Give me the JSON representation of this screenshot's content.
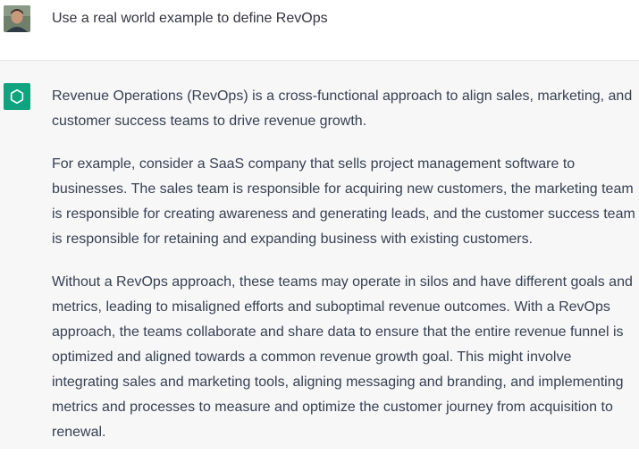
{
  "user_message": {
    "text": "Use a real world example to define RevOps"
  },
  "assistant_message": {
    "paragraphs": [
      {
        "lines": [
          "Revenue Operations (RevOps) is a cross-functional approach to align sales, marketing, and",
          "customer success teams to drive revenue growth."
        ]
      },
      {
        "lines": [
          "For example, consider a SaaS company that sells project management software to",
          "businesses. The sales team is responsible for acquiring new customers, the marketing team",
          "is responsible for creating awareness and generating leads, and the customer success team",
          "is responsible for retaining and expanding business with existing customers."
        ]
      },
      {
        "lines": [
          "Without a RevOps approach, these teams may operate in silos and have different goals and",
          "metrics, leading to misaligned efforts and suboptimal revenue outcomes. With a RevOps",
          "approach, the teams collaborate and share data to ensure that the entire revenue funnel is",
          "optimized and aligned towards a common revenue growth goal. This might involve",
          "integrating sales and marketing tools, aligning messaging and branding, and implementing",
          "metrics and processes to measure and optimize the customer journey from acquisition to",
          "renewal."
        ]
      }
    ]
  },
  "colors": {
    "assistant_avatar_bg": "#10a37f",
    "assistant_row_bg": "#f7f7f8",
    "text": "#374151"
  },
  "icons": {
    "user_avatar": "user-photo-avatar",
    "assistant_avatar": "openai-logo-icon"
  }
}
